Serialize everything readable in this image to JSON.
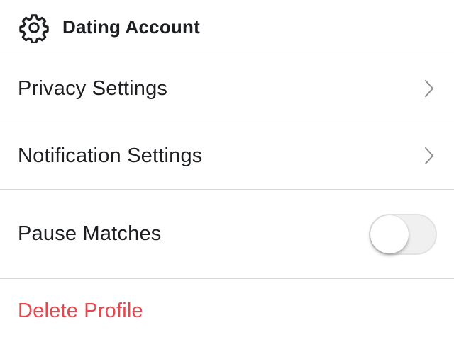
{
  "header": {
    "title": "Dating Account",
    "icon": "gear-icon"
  },
  "settings": {
    "privacy_label": "Privacy Settings",
    "notification_label": "Notification Settings",
    "pause_label": "Pause Matches",
    "pause_enabled": false,
    "delete_label": "Delete Profile"
  },
  "colors": {
    "delete": "#e5484d",
    "divider": "#d6d6d6",
    "chevron": "#8e8e93"
  }
}
